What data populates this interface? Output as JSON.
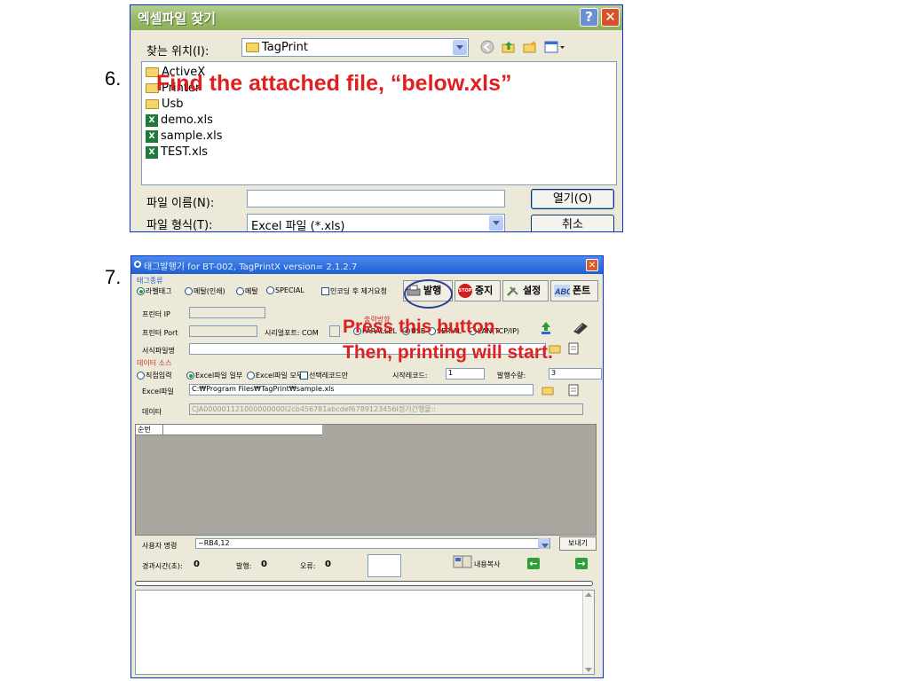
{
  "steps": {
    "step6": "6.",
    "step7": "7."
  },
  "file_dialog": {
    "title": "엑셀파일 찾기",
    "help_label": "?",
    "close_label": "✕",
    "look_in_label": "찾는 위치(I):",
    "look_in_value": "TagPrint",
    "items": [
      {
        "name": "ActiveX",
        "icon": "folder-icon"
      },
      {
        "name": "Printer",
        "icon": "folder-icon"
      },
      {
        "name": "Usb",
        "icon": "folder-icon"
      },
      {
        "name": "demo.xls",
        "icon": "excel-file-icon"
      },
      {
        "name": "sample.xls",
        "icon": "excel-file-icon"
      },
      {
        "name": "TEST.xls",
        "icon": "excel-file-icon"
      }
    ],
    "filename_label": "파일 이름(N):",
    "filename_value": "",
    "filetype_label": "파일 형식(T):",
    "filetype_value": "Excel 파일 (*.xls)",
    "open_button": "열기(O)",
    "cancel_button": "취소"
  },
  "annotations": {
    "find_file": "Find the attached file, “below.xls”",
    "press_button": "Press this button.",
    "then_printing": "Then, printing will start."
  },
  "app": {
    "title": "태그발행기 for BT-002, TagPrintX version= 2.1.2.7",
    "close_label": "✕",
    "tag_type_section": "태그종류",
    "tag_types": [
      "라벨태그",
      "메탈(인쇄)",
      "메탈",
      "SPECIAL"
    ],
    "after_encode_label": "인코딩 후 제거요청",
    "toolbar": {
      "print": "발행",
      "stop": "중지",
      "settings": "설정",
      "font": "폰트",
      "stop_badge": "STOP"
    },
    "printer_ip_label": "프린터 IP",
    "printer_port_label": "프린터 Port",
    "serial_port_label": "시리얼포트: COM",
    "output_method_label": "출력방향",
    "output_options": [
      "PARALLEL",
      "USB",
      "SERIAL",
      "LAN(TCP/IP)"
    ],
    "format_file_label": "서식파일명",
    "data_source_section": "데이터 소스",
    "data_sources": [
      "직접입력",
      "Excel파일 일부",
      "Excel파일 모두"
    ],
    "selected_only_label": "선택레코드만",
    "start_code_label": "시작레코드:",
    "start_code_value": "1",
    "count_label": "발행수량:",
    "count_value": "3",
    "excel_file_label": "Excel파일",
    "excel_file_value": "C:₩Program Files₩TagPrint₩sample.xls",
    "data_label": "데이타",
    "data_value": "CJA000001121000000000I2cb456781abcdef6789123456I정기간행물::",
    "grid_header": "순번",
    "user_command_label": "사용자 명령",
    "user_command_value": "~RB4,12",
    "send_button": "보내기",
    "elapsed_label": "경과시간(초):",
    "elapsed_value": "0",
    "issued_label": "발행:",
    "issued_value": "0",
    "error_label": "오류:",
    "error_value": "0",
    "copy_content_label": "내용복사"
  },
  "colors": {
    "annotation": "#e02020",
    "circle": "#2b3f9e",
    "xp_blue": "#0831d9"
  }
}
